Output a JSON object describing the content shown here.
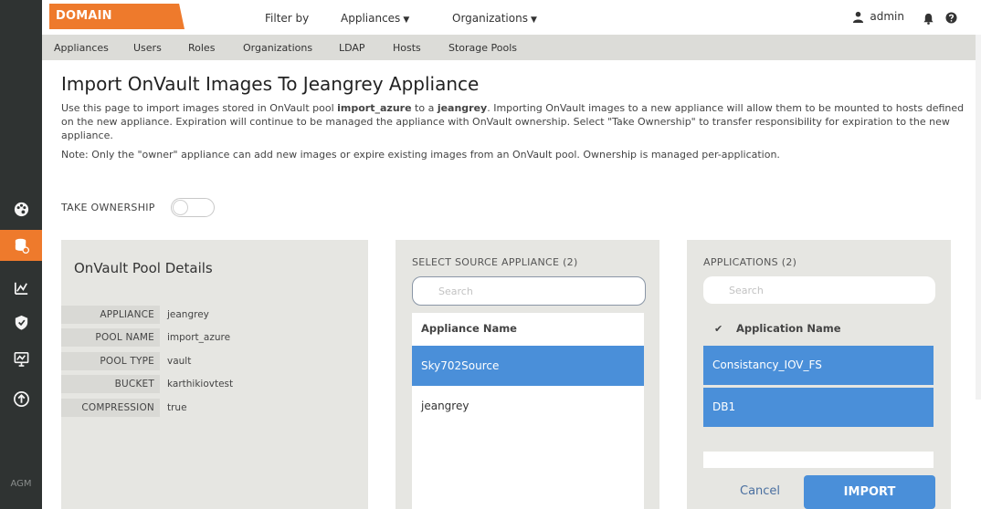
{
  "header": {
    "brand": "DOMAIN MANAGER",
    "filter_label": "Filter by",
    "appliances_menu": "Appliances",
    "organizations_menu": "Organizations",
    "user": "admin"
  },
  "subnav": [
    "Appliances",
    "Users",
    "Roles",
    "Organizations",
    "LDAP",
    "Hosts",
    "Storage Pools"
  ],
  "rail": {
    "agm_label": "AGM"
  },
  "page": {
    "title": "Import OnVault Images To Jeangrey Appliance",
    "desc_a": "Use this page to import images stored in OnVault pool ",
    "desc_pool": "import_azure",
    "desc_b": " to a ",
    "desc_appliance": "jeangrey",
    "desc_c": ". Importing OnVault images to a new appliance will allow them to be mounted to hosts defined on the new appliance. Expiration will continue to be managed the appliance with OnVault ownership. Select \"Take Ownership\" to transfer responsibility for expiration to the new appliance.",
    "note": "Note: Only the \"owner\" appliance can add new images or expire existing images from an OnVault pool. Ownership is managed per-application."
  },
  "take_ownership": {
    "label": "TAKE OWNERSHIP"
  },
  "pool_details": {
    "title": "OnVault Pool Details",
    "rows": [
      {
        "key": "APPLIANCE",
        "value": "jeangrey"
      },
      {
        "key": "POOL NAME",
        "value": "import_azure"
      },
      {
        "key": "POOL TYPE",
        "value": "vault"
      },
      {
        "key": "BUCKET",
        "value": "karthikiovtest"
      },
      {
        "key": "COMPRESSION",
        "value": "true"
      }
    ]
  },
  "source": {
    "title": "SELECT SOURCE APPLIANCE (2)",
    "search_placeholder": "Search",
    "column": "Appliance Name",
    "rows": [
      "Sky702Source",
      "jeangrey"
    ]
  },
  "applications": {
    "title": "APPLICATIONS (2)",
    "search_placeholder": "Search",
    "column": "Application Name",
    "check": "✔",
    "rows": [
      "Consistancy_IOV_FS",
      "DB1"
    ]
  },
  "actions": {
    "cancel": "Cancel",
    "import": "IMPORT"
  },
  "colors": {
    "accent": "#ee7a2c",
    "selected": "#4a8fd9",
    "rail": "#2f3332"
  }
}
